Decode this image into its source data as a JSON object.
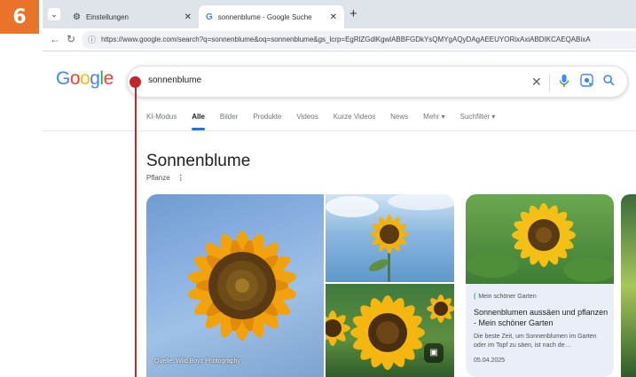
{
  "step_number": "6",
  "browser": {
    "tabs": [
      {
        "title": "Einstellungen",
        "icon": "gear-icon",
        "active": false
      },
      {
        "title": "sonnenblume - Google Suche",
        "icon": "google-icon",
        "active": true
      }
    ],
    "url": "https://www.google.com/search?q=sonnenblume&oq=sonnenblume&gs_lcrp=EgRlZGdlKgwlABBFGDkYsQMYgAQyDAgAEEUYORixAxiABDIKCAEQABixA"
  },
  "google": {
    "logo": "Google",
    "query": "sonnenblume",
    "nav_tabs": [
      "KI-Modus",
      "Alle",
      "Bilder",
      "Produkte",
      "Videos",
      "Kurze Videos",
      "News",
      "Mehr ▾",
      "Suchfilter ▾"
    ],
    "active_tab": "Alle",
    "knowledge_panel": {
      "title": "Sonnenblume",
      "subtitle": "Pflanze",
      "image_caption": "Quelle: Wild Boyz Photography"
    },
    "card": {
      "source": "Mein schöner Garten",
      "title": "Sonnenblumen aussäen und pflanzen - Mein schöner Garten",
      "description": "Die beste Zeit, um Sonnenblumen im Garten oder im Topf zu säen, ist nach de…",
      "date": "05.04.2025"
    }
  },
  "colors": {
    "accent": "#1a73e8",
    "pointer": "#c0272d",
    "badge": "#e8732a"
  }
}
